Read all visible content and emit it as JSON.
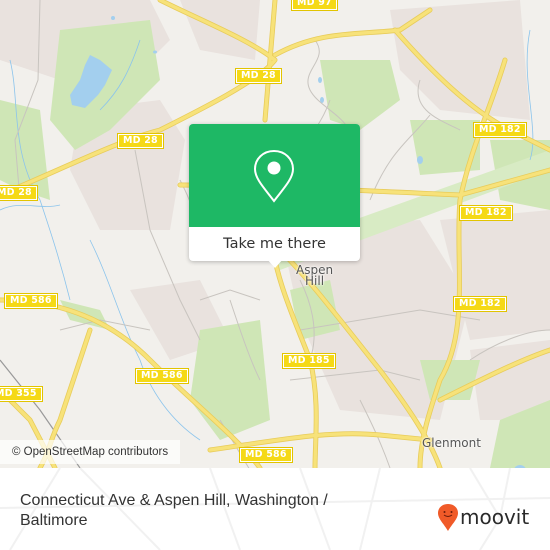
{
  "map": {
    "road_labels": [
      {
        "text": "MD 97",
        "id": "md97-top"
      },
      {
        "text": "MD 28",
        "id": "md28-upper"
      },
      {
        "text": "MD 28",
        "id": "md28-mid"
      },
      {
        "text": "MD 28",
        "id": "md28-left"
      },
      {
        "text": "MD 182",
        "id": "md182-upper"
      },
      {
        "text": "MD 182",
        "id": "md182-mid"
      },
      {
        "text": "MD 182",
        "id": "md182-lower"
      },
      {
        "text": "MD 586",
        "id": "md586-left"
      },
      {
        "text": "MD 586",
        "id": "md586-mid"
      },
      {
        "text": "MD 586",
        "id": "md586-bottom"
      },
      {
        "text": "MD 355",
        "id": "md355"
      },
      {
        "text": "MD 185",
        "id": "md185"
      }
    ],
    "places": [
      {
        "text": "Aspen\nHill",
        "line1": "Aspen",
        "line2": "Hill"
      },
      {
        "text": "Glenmont"
      }
    ],
    "attribution": "© OpenStreetMap contributors",
    "colors": {
      "background": "#f2f0ec",
      "park": "#cfe8b4",
      "residential": "#e8e0dc",
      "water": "#a3cfee",
      "road_major": "#f7e27a",
      "shield": "#f5d916"
    }
  },
  "popup": {
    "icon": "map-pin-icon",
    "button_label": "Take me there",
    "color": "#1eb865"
  },
  "footer": {
    "title": "Connecticut Ave & Aspen Hill, Washington / Baltimore",
    "brand": "moovit",
    "brand_color": "#f05a28"
  }
}
